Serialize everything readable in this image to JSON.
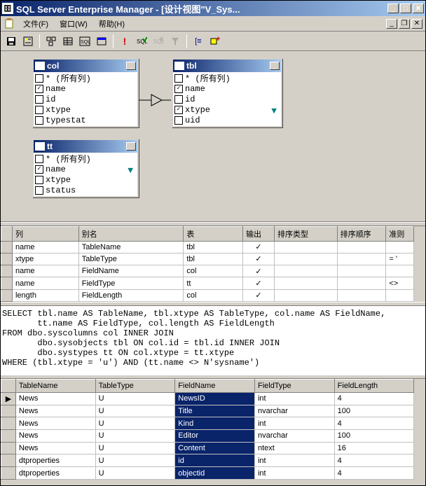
{
  "title": "SQL Server Enterprise Manager - [设计视图\"V_Sys...",
  "menu": {
    "file": "文件(F)",
    "window": "窗口(W)",
    "help": "帮助(H)"
  },
  "tables_pane": {
    "col": {
      "title": "col",
      "fields": [
        {
          "label": "* (所有列)",
          "checked": false
        },
        {
          "label": "name",
          "checked": true
        },
        {
          "label": "id",
          "checked": false
        },
        {
          "label": "xtype",
          "checked": false
        },
        {
          "label": "typestat",
          "checked": false
        }
      ]
    },
    "tbl": {
      "title": "tbl",
      "fields": [
        {
          "label": "* (所有列)",
          "checked": false
        },
        {
          "label": "name",
          "checked": true
        },
        {
          "label": "id",
          "checked": false
        },
        {
          "label": "xtype",
          "checked": true,
          "filter": true
        },
        {
          "label": "uid",
          "checked": false
        }
      ]
    },
    "tt": {
      "title": "tt",
      "fields": [
        {
          "label": "* (所有列)",
          "checked": false
        },
        {
          "label": "name",
          "checked": true,
          "filter": true
        },
        {
          "label": "xtype",
          "checked": false
        },
        {
          "label": "status",
          "checked": false
        }
      ]
    }
  },
  "grid": {
    "headers": [
      "列",
      "别名",
      "表",
      "输出",
      "排序类型",
      "排序顺序",
      "准则"
    ],
    "rows": [
      {
        "col": "name",
        "alias": "TableName",
        "table": "tbl",
        "out": true,
        "crit": ""
      },
      {
        "col": "xtype",
        "alias": "TableType",
        "table": "tbl",
        "out": true,
        "crit": "= '"
      },
      {
        "col": "name",
        "alias": "FieldName",
        "table": "col",
        "out": true,
        "crit": ""
      },
      {
        "col": "name",
        "alias": "FieldType",
        "table": "tt",
        "out": true,
        "crit": "<>"
      },
      {
        "col": "length",
        "alias": "FieldLength",
        "table": "col",
        "out": true,
        "crit": ""
      }
    ]
  },
  "sql": "SELECT tbl.name AS TableName, tbl.xtype AS TableType, col.name AS FieldName,\n       tt.name AS FieldType, col.length AS FieldLength\nFROM dbo.syscolumns col INNER JOIN\n       dbo.sysobjects tbl ON col.id = tbl.id INNER JOIN\n       dbo.systypes tt ON col.xtype = tt.xtype\nWHERE (tbl.xtype = 'u') AND (tt.name <> N'sysname')",
  "results": {
    "headers": [
      "TableName",
      "TableType",
      "FieldName",
      "FieldType",
      "FieldLength"
    ],
    "rows": [
      {
        "r": [
          "News",
          "U",
          "NewsID",
          "int",
          "4"
        ]
      },
      {
        "r": [
          "News",
          "U",
          "Title",
          "nvarchar",
          "100"
        ]
      },
      {
        "r": [
          "News",
          "U",
          "Kind",
          "int",
          "4"
        ]
      },
      {
        "r": [
          "News",
          "U",
          "Editor",
          "nvarchar",
          "100"
        ]
      },
      {
        "r": [
          "News",
          "U",
          "Content",
          "ntext",
          "16"
        ]
      },
      {
        "r": [
          "dtproperties",
          "U",
          "id",
          "int",
          "4"
        ]
      },
      {
        "r": [
          "dtproperties",
          "U",
          "objectid",
          "int",
          "4"
        ]
      }
    ]
  }
}
